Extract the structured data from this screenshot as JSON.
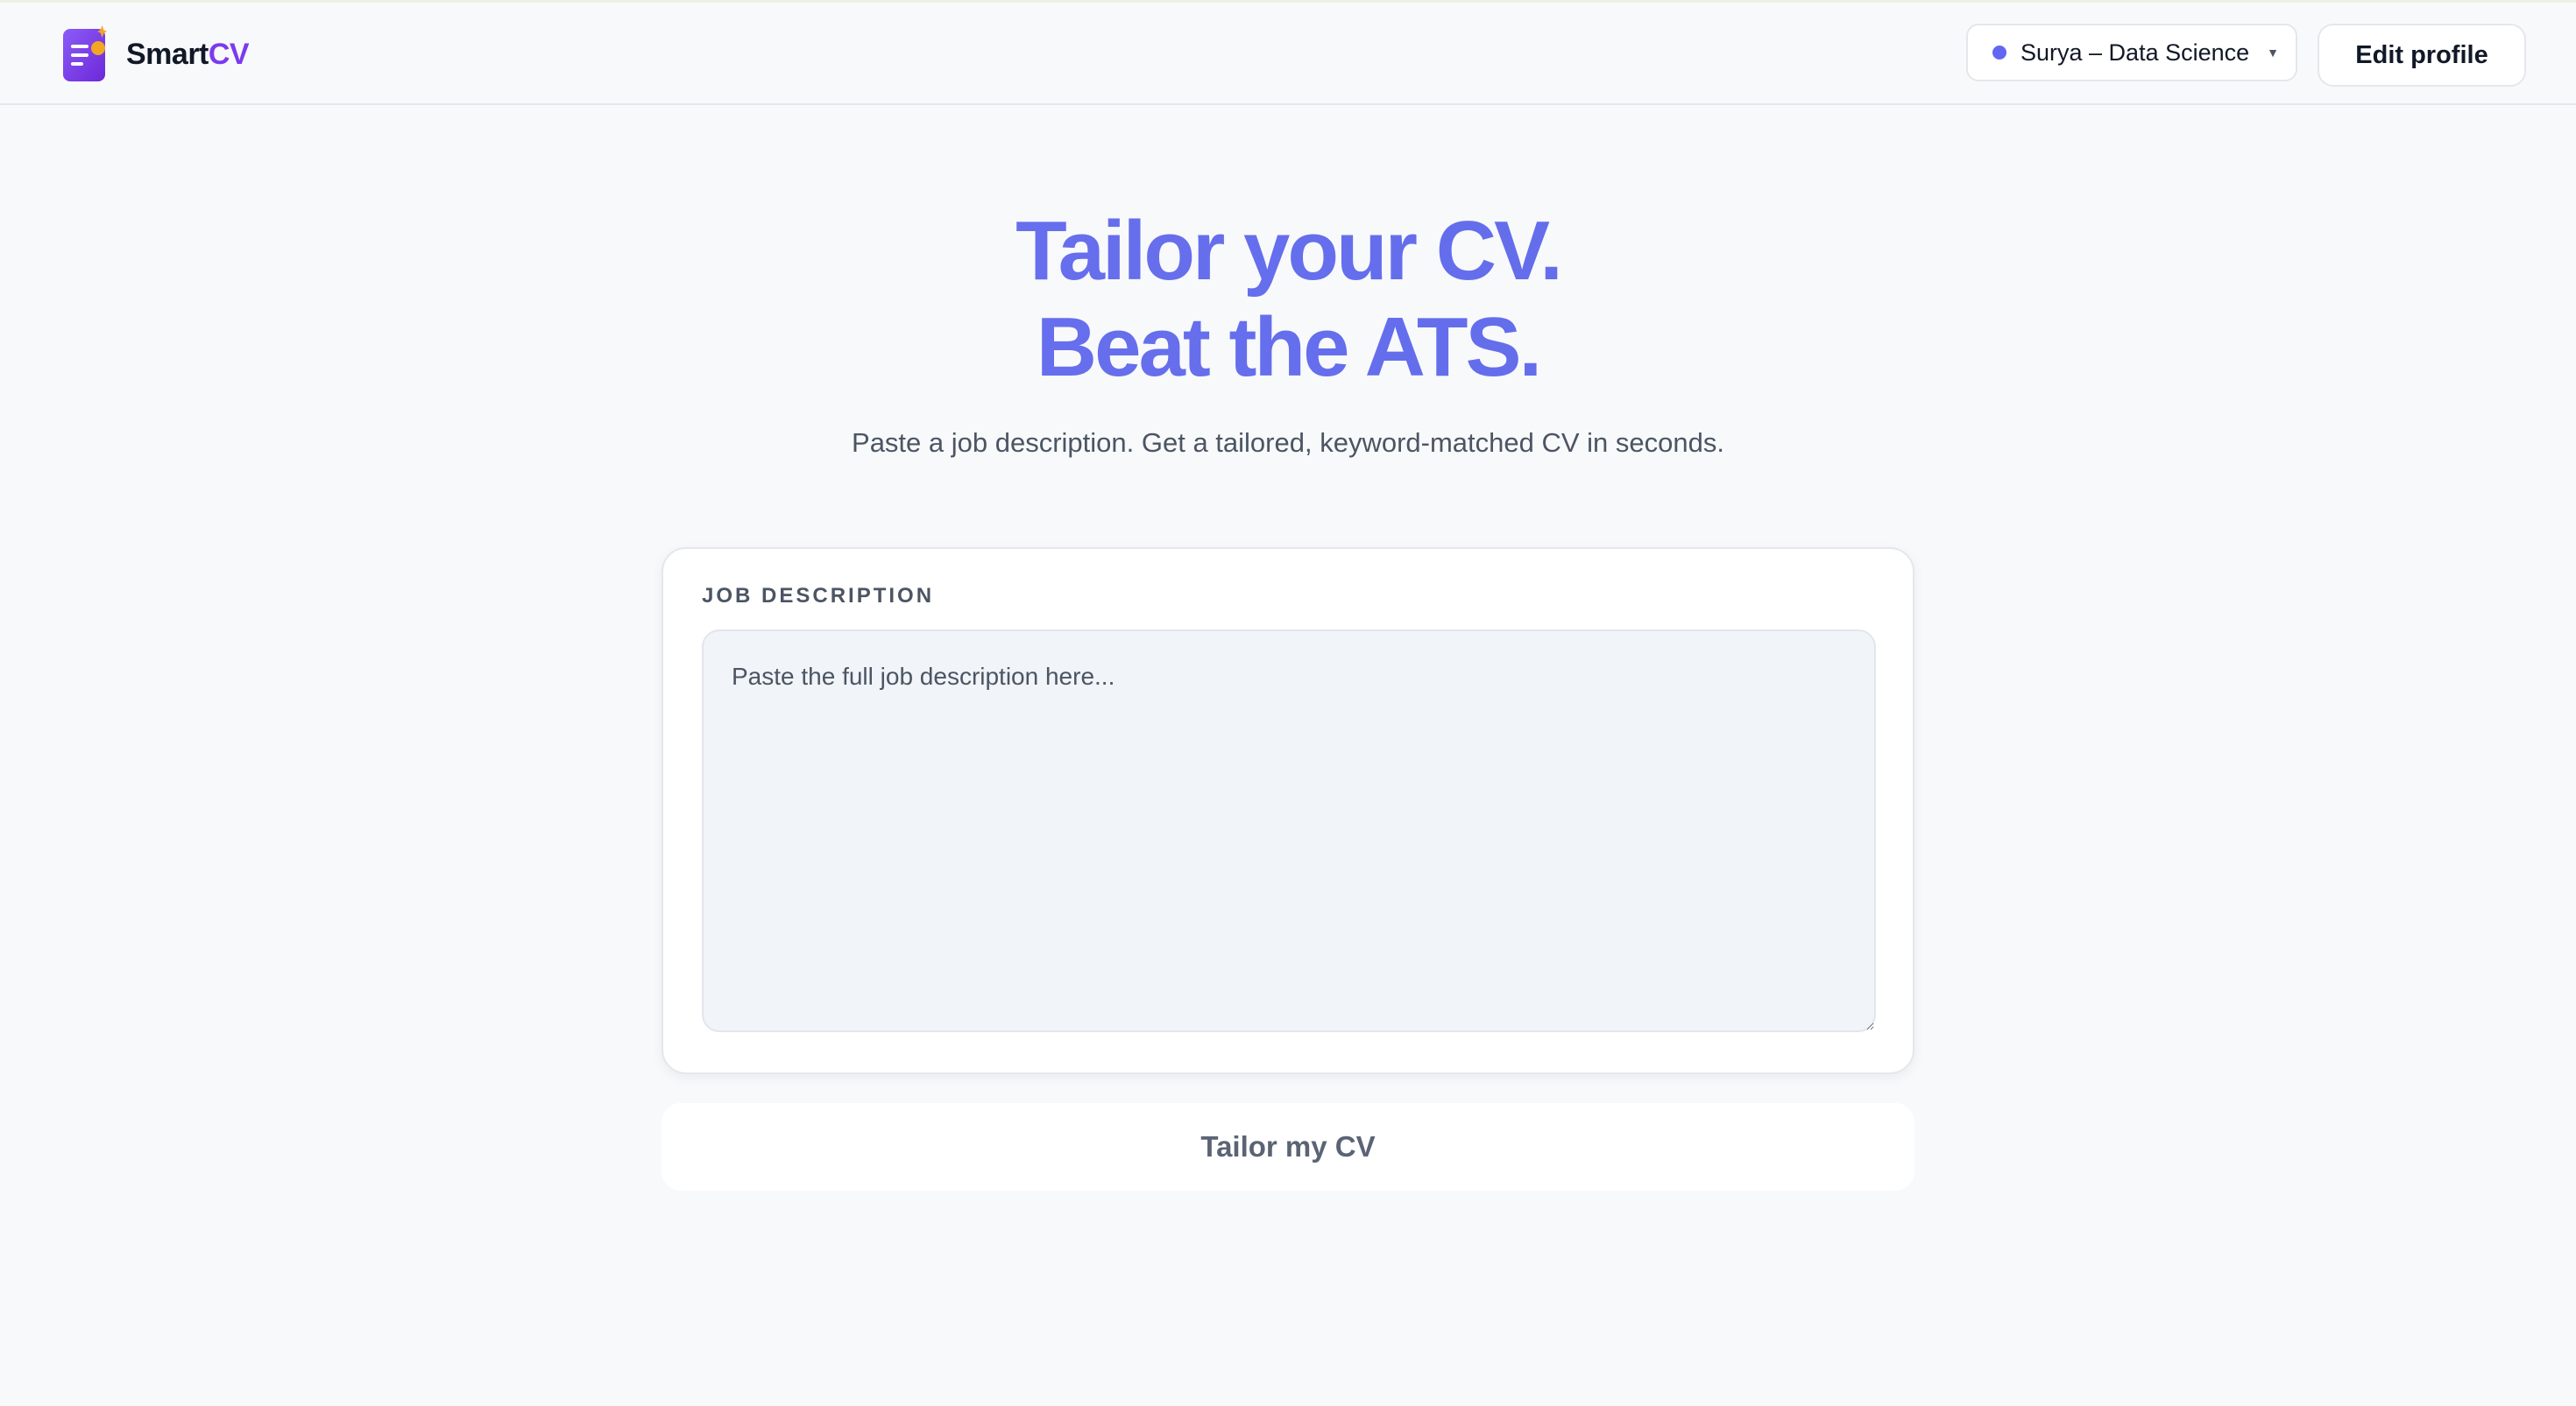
{
  "header": {
    "logo": {
      "name_primary": "Smart",
      "name_accent": "CV",
      "icon": "document-sparkle-icon"
    },
    "profile_selector": {
      "selected": "Surya – Data Science",
      "status_color": "#6366f1",
      "icon": "caret-down-icon"
    },
    "edit_profile_label": "Edit profile"
  },
  "hero": {
    "title_line1": "Tailor your CV.",
    "title_line2": "Beat the ATS.",
    "subtitle": "Paste a job description. Get a tailored, keyword-matched CV in seconds."
  },
  "job_description": {
    "label": "JOB DESCRIPTION",
    "value": "",
    "placeholder": "Paste the full job description here..."
  },
  "actions": {
    "tailor_label": "Tailor my CV"
  },
  "colors": {
    "accent": "#6366f1",
    "brand_purple": "#7c3aed",
    "background": "#f8f9fb"
  }
}
